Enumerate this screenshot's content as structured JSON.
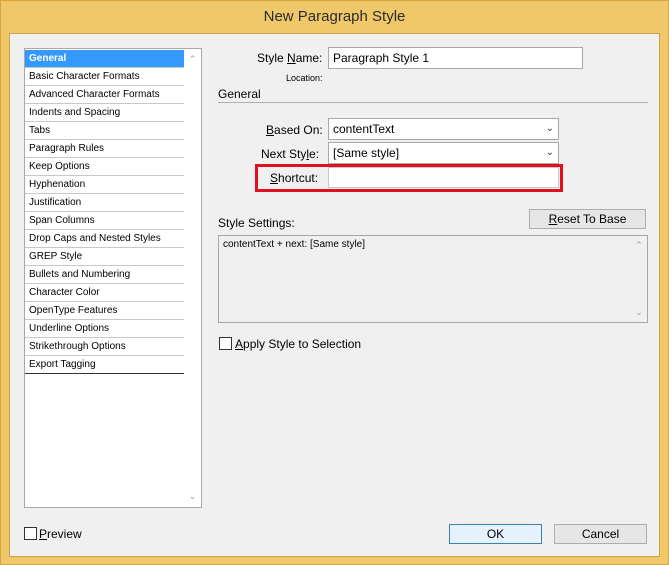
{
  "window": {
    "title": "New Paragraph Style"
  },
  "sidebar": {
    "items": [
      {
        "label": "General",
        "selected": true
      },
      {
        "label": "Basic Character Formats"
      },
      {
        "label": "Advanced Character Formats"
      },
      {
        "label": "Indents and Spacing"
      },
      {
        "label": "Tabs"
      },
      {
        "label": "Paragraph Rules"
      },
      {
        "label": "Keep Options"
      },
      {
        "label": "Hyphenation"
      },
      {
        "label": "Justification"
      },
      {
        "label": "Span Columns"
      },
      {
        "label": "Drop Caps and Nested Styles"
      },
      {
        "label": "GREP Style"
      },
      {
        "label": "Bullets and Numbering"
      },
      {
        "label": "Character Color"
      },
      {
        "label": "OpenType Features"
      },
      {
        "label": "Underline Options"
      },
      {
        "label": "Strikethrough Options"
      },
      {
        "label": "Export Tagging"
      }
    ]
  },
  "form": {
    "style_name_label_pre": "Style ",
    "style_name_label_ul": "N",
    "style_name_label_post": "ame:",
    "style_name_value": "Paragraph Style 1",
    "location_label": "Location:",
    "section_title": "General",
    "based_on_label_ul": "B",
    "based_on_label_post": "ased On:",
    "based_on_value": "contentText",
    "next_style_label_pre": "Next Sty",
    "next_style_label_ul": "l",
    "next_style_label_post": "e:",
    "next_style_value": "[Same style]",
    "shortcut_label_ul": "S",
    "shortcut_label_post": "hortcut:",
    "shortcut_value": "",
    "style_settings_label": "Style Settings:",
    "reset_label_ul": "R",
    "reset_label_post": "eset To Base",
    "style_settings_text": "contentText + next: [Same style]",
    "apply_label_ul": "A",
    "apply_label_post": "pply Style to Selection",
    "apply_checked": false
  },
  "footer": {
    "preview_label_ul": "P",
    "preview_label_post": "review",
    "preview_checked": false,
    "ok_label": "OK",
    "cancel_label": "Cancel"
  },
  "colors": {
    "frame": "#f0c86a",
    "selection": "#3399ff",
    "highlight": "#e01020"
  },
  "icons": {
    "scroll_up": "chevron-up-icon",
    "scroll_down": "chevron-down-icon",
    "dropdown": "chevron-down-icon"
  }
}
